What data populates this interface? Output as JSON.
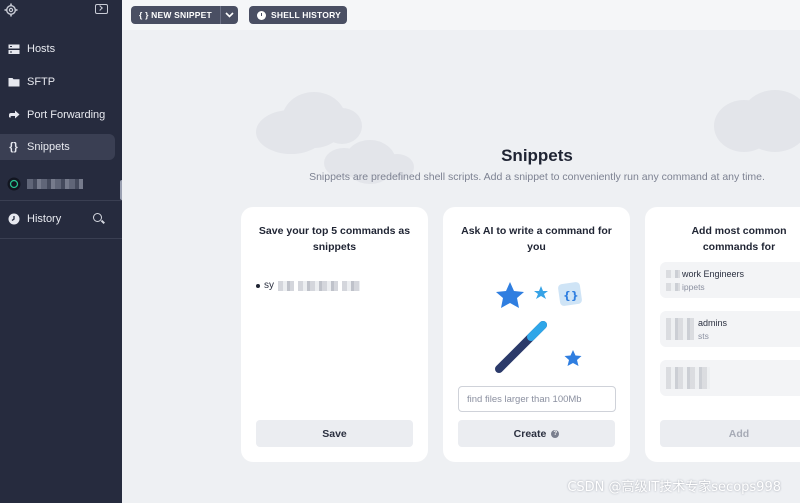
{
  "sidebar": {
    "items": [
      {
        "label": "Hosts",
        "icon": "server-icon"
      },
      {
        "label": "SFTP",
        "icon": "folder-icon"
      },
      {
        "label": "Port Forwarding",
        "icon": "arrow-forward-icon"
      },
      {
        "label": "Snippets",
        "icon": "braces-icon",
        "active": true
      },
      {
        "label": "History",
        "icon": "clock-icon"
      }
    ]
  },
  "toolbar": {
    "new_snippet_label": "{ } NEW SNIPPET",
    "shell_history_label": "SHELL HISTORY"
  },
  "main": {
    "title": "Snippets",
    "subtitle": "Snippets are predefined shell scripts. Add a snippet to conveniently run any command at any time.",
    "cards": {
      "save": {
        "title": "Save your top 5 commands as snippets",
        "bullet_text": "sy",
        "button_label": "Save"
      },
      "ai": {
        "title": "Ask AI to write a command for you",
        "input_placeholder": "find files larger than 100Mb",
        "button_label": "Create"
      },
      "common": {
        "title": "Add most common commands for",
        "items": [
          {
            "title": "work Engineers",
            "sub": "ippets"
          },
          {
            "title": "admins",
            "sub": "sts"
          },
          {
            "title": "",
            "sub": ""
          }
        ],
        "button_label": "Add"
      }
    }
  },
  "watermark": "CSDN @高级IT技术专家secops998",
  "colors": {
    "sidebar_bg": "#262b3e",
    "accent_blue": "#2f9de0",
    "page_bg": "#eef0f3"
  }
}
